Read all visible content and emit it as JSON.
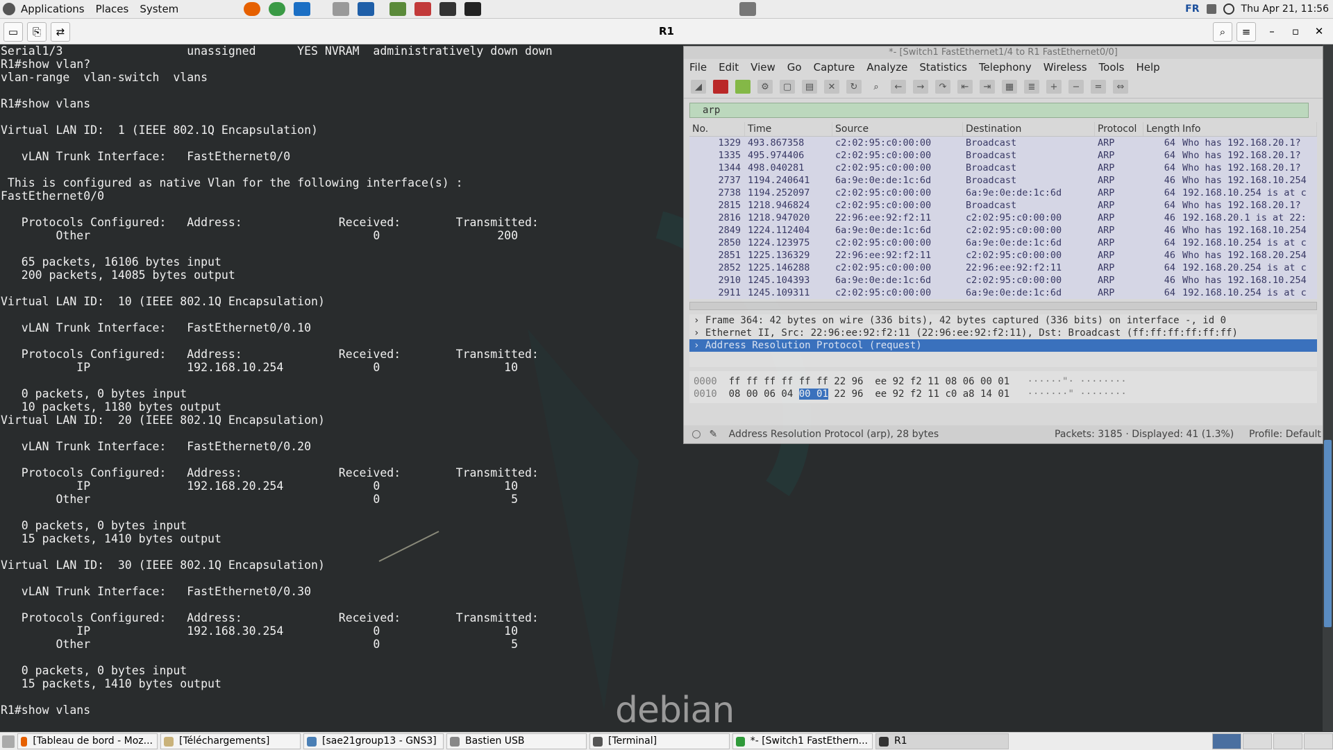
{
  "topbar": {
    "menu": [
      "Applications",
      "Places",
      "System"
    ],
    "keyboard_layout": "FR",
    "datetime": "Thu Apr 21, 11:56"
  },
  "window": {
    "title": "R1"
  },
  "terminal": {
    "lines": [
      "Serial1/3                  unassigned      YES NVRAM  administratively down down",
      "R1#show vlan?",
      "vlan-range  vlan-switch  vlans",
      "",
      "R1#show vlans",
      "",
      "Virtual LAN ID:  1 (IEEE 802.1Q Encapsulation)",
      "",
      "   vLAN Trunk Interface:   FastEthernet0/0",
      "",
      " This is configured as native Vlan for the following interface(s) :",
      "FastEthernet0/0",
      "",
      "   Protocols Configured:   Address:              Received:        Transmitted:",
      "        Other                                         0                 200",
      "",
      "   65 packets, 16106 bytes input",
      "   200 packets, 14085 bytes output",
      "",
      "Virtual LAN ID:  10 (IEEE 802.1Q Encapsulation)",
      "",
      "   vLAN Trunk Interface:   FastEthernet0/0.10",
      "",
      "   Protocols Configured:   Address:              Received:        Transmitted:",
      "           IP              192.168.10.254             0                  10",
      "",
      "   0 packets, 0 bytes input",
      "   10 packets, 1180 bytes output",
      "Virtual LAN ID:  20 (IEEE 802.1Q Encapsulation)",
      "",
      "   vLAN Trunk Interface:   FastEthernet0/0.20",
      "",
      "   Protocols Configured:   Address:              Received:        Transmitted:",
      "           IP              192.168.20.254             0                  10",
      "        Other                                         0                   5",
      "",
      "   0 packets, 0 bytes input",
      "   15 packets, 1410 bytes output",
      "",
      "Virtual LAN ID:  30 (IEEE 802.1Q Encapsulation)",
      "",
      "   vLAN Trunk Interface:   FastEthernet0/0.30",
      "",
      "   Protocols Configured:   Address:              Received:        Transmitted:",
      "           IP              192.168.30.254             0                  10",
      "        Other                                         0                   5",
      "",
      "   0 packets, 0 bytes input",
      "   15 packets, 1410 bytes output",
      "",
      "R1#show vlans"
    ],
    "wallpaper_logo": "debian"
  },
  "wireshark": {
    "title": "*- [Switch1 FastEthernet1/4 to R1 FastEthernet0/0]",
    "menu": [
      "File",
      "Edit",
      "View",
      "Go",
      "Capture",
      "Analyze",
      "Statistics",
      "Telephony",
      "Wireless",
      "Tools",
      "Help"
    ],
    "filter": "arp",
    "columns": [
      "No.",
      "Time",
      "Source",
      "Destination",
      "Protocol",
      "Length",
      "Info"
    ],
    "rows": [
      [
        "1329",
        "493.867358",
        "c2:02:95:c0:00:00",
        "Broadcast",
        "ARP",
        "64",
        "Who has 192.168.20.1?"
      ],
      [
        "1335",
        "495.974406",
        "c2:02:95:c0:00:00",
        "Broadcast",
        "ARP",
        "64",
        "Who has 192.168.20.1?"
      ],
      [
        "1344",
        "498.040281",
        "c2:02:95:c0:00:00",
        "Broadcast",
        "ARP",
        "64",
        "Who has 192.168.20.1?"
      ],
      [
        "2737",
        "1194.240641",
        "6a:9e:0e:de:1c:6d",
        "Broadcast",
        "ARP",
        "46",
        "Who has 192.168.10.254"
      ],
      [
        "2738",
        "1194.252097",
        "c2:02:95:c0:00:00",
        "6a:9e:0e:de:1c:6d",
        "ARP",
        "64",
        "192.168.10.254 is at c"
      ],
      [
        "2815",
        "1218.946824",
        "c2:02:95:c0:00:00",
        "Broadcast",
        "ARP",
        "64",
        "Who has 192.168.20.1?"
      ],
      [
        "2816",
        "1218.947020",
        "22:96:ee:92:f2:11",
        "c2:02:95:c0:00:00",
        "ARP",
        "46",
        "192.168.20.1 is at 22:"
      ],
      [
        "2849",
        "1224.112404",
        "6a:9e:0e:de:1c:6d",
        "c2:02:95:c0:00:00",
        "ARP",
        "46",
        "Who has 192.168.10.254"
      ],
      [
        "2850",
        "1224.123975",
        "c2:02:95:c0:00:00",
        "6a:9e:0e:de:1c:6d",
        "ARP",
        "64",
        "192.168.10.254 is at c"
      ],
      [
        "2851",
        "1225.136329",
        "22:96:ee:92:f2:11",
        "c2:02:95:c0:00:00",
        "ARP",
        "46",
        "Who has 192.168.20.254"
      ],
      [
        "2852",
        "1225.146288",
        "c2:02:95:c0:00:00",
        "22:96:ee:92:f2:11",
        "ARP",
        "64",
        "192.168.20.254 is at c"
      ],
      [
        "2910",
        "1245.104393",
        "6a:9e:0e:de:1c:6d",
        "c2:02:95:c0:00:00",
        "ARP",
        "46",
        "Who has 192.168.10.254"
      ],
      [
        "2911",
        "1245.109311",
        "c2:02:95:c0:00:00",
        "6a:9e:0e:de:1c:6d",
        "ARP",
        "64",
        "192.168.10.254 is at c"
      ]
    ],
    "details": [
      "Frame 364: 42 bytes on wire (336 bits), 42 bytes captured (336 bits) on interface -, id 0",
      "Ethernet II, Src: 22:96:ee:92:f2:11 (22:96:ee:92:f2:11), Dst: Broadcast (ff:ff:ff:ff:ff:ff)",
      "Address Resolution Protocol (request)"
    ],
    "hex": [
      {
        "offset": "0000",
        "pre": "ff ff ff ff ff ff 22 96  ee 92 f2 11 08 06 00 01",
        "hi": "",
        "post": "",
        "ascii": "······\"· ········"
      },
      {
        "offset": "0010",
        "pre": "08 00 06 04 ",
        "hi": "00 01",
        "post": " 22 96  ee 92 f2 11 c0 a8 14 01",
        "ascii": "·······\" ········"
      }
    ],
    "status_left": "Address Resolution Protocol (arp), 28 bytes",
    "status_packets": "Packets: 3185 · Displayed: 41 (1.3%)",
    "status_profile": "Profile: Default"
  },
  "taskbar": {
    "items": [
      {
        "label": "[Tableau de bord - Moz...",
        "icon_color": "#e66000"
      },
      {
        "label": "[Téléchargements]",
        "icon_color": "#c9b27a"
      },
      {
        "label": "[sae21group13 - GNS3]",
        "icon_color": "#4a7fb5"
      },
      {
        "label": "Bastien USB",
        "icon_color": "#888888"
      },
      {
        "label": "[Terminal]",
        "icon_color": "#555555"
      },
      {
        "label": "*- [Switch1 FastEthern...",
        "icon_color": "#2f9a3a"
      },
      {
        "label": "R1",
        "icon_color": "#333333"
      }
    ]
  }
}
